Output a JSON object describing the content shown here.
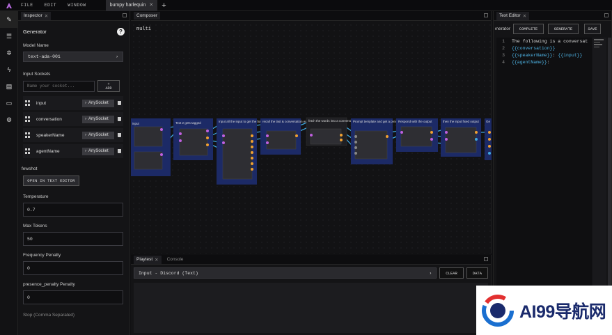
{
  "menubar": {
    "items": [
      "FILE",
      "EDIT",
      "WINDOW"
    ],
    "doc_tab": "bumpy harlequin",
    "new_tab": "+"
  },
  "rail": {
    "icons": [
      "wrench-icon",
      "list-icon",
      "nodes-icon",
      "bolt-icon",
      "book-icon",
      "terminal-icon",
      "gear-icon"
    ]
  },
  "inspector": {
    "tab_label": "Inspector",
    "title": "Generator",
    "help": "?",
    "model_label": "Model Name",
    "model_value": "text-ada-001",
    "input_sockets_label": "Input Sockets",
    "socket_placeholder": "Name your socket...",
    "add_plus": "+",
    "add_label": "ADD",
    "sockets": [
      {
        "name": "input",
        "type": "AnySocket"
      },
      {
        "name": "conversation",
        "type": "AnySocket"
      },
      {
        "name": "speakerName",
        "type": "AnySocket"
      },
      {
        "name": "agentName",
        "type": "AnySocket"
      }
    ],
    "fewshot_label": "fewshot",
    "open_editor_label": "OPEN IN TEXT EDITOR",
    "temperature_label": "Temperature",
    "temperature_value": "0.7",
    "max_tokens_label": "Max Tokens",
    "max_tokens_value": "50",
    "frequency_label": "Frequency Penalty",
    "frequency_value": "0",
    "presence_label": "presence_penalty Penalty",
    "presence_value": "0",
    "stop_label": "Stop (Comma Separated)"
  },
  "composer": {
    "tab_label": "Composer",
    "spell_name": "multi",
    "node_titles": [
      "input",
      "Text 2 gets tagged",
      "Input all the input to get the basic fields",
      "recall the last & conversation events again",
      "fetch the words into a conversation piece",
      "Prompt template and get a prediction",
      "Respond with the output",
      "then the input fixed output",
      "Ge"
    ]
  },
  "playtest": {
    "tabs": [
      "Playtest",
      "Console"
    ],
    "input_select": "Input - Discord (Text)",
    "clear_label": "CLEAR",
    "data_label": "DATA"
  },
  "texteditor": {
    "tab_label": "Text Editor",
    "name_label": "Generator",
    "complete_label": "COMPLETE",
    "generate_label": "GENERATE",
    "save_label": "SAVE",
    "lines": [
      {
        "n": "1",
        "parts": [
          {
            "t": "The following is a conversat",
            "v": false
          }
        ]
      },
      {
        "n": "2",
        "parts": [
          {
            "t": "{{conversation}}",
            "v": true
          }
        ]
      },
      {
        "n": "3",
        "parts": [
          {
            "t": "{{speakerName}}",
            "v": true
          },
          {
            "t": ": ",
            "v": false
          },
          {
            "t": "{{input}}",
            "v": true
          }
        ]
      },
      {
        "n": "4",
        "parts": [
          {
            "t": "{{agentName}}",
            "v": true
          },
          {
            "t": ":",
            "v": false
          }
        ]
      }
    ]
  },
  "watermark": {
    "text": "AI99导航网"
  },
  "colors": {
    "background": "#101012",
    "panel": "#141416",
    "node_highlight": "#1c2a66",
    "node_body": "#2e2e33",
    "wire": "#3fa7e0",
    "socket_orange": "#f0a030",
    "socket_purple": "#c060e0",
    "code_variable": "#4fb6e8"
  }
}
